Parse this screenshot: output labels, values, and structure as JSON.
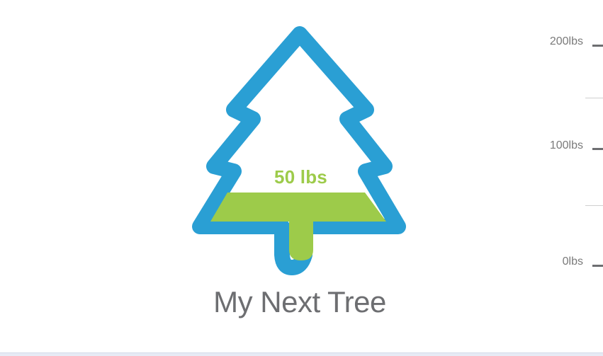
{
  "tree": {
    "title": "My Next Tree",
    "fill_label": "50 lbs",
    "current_lbs": 50,
    "max_lbs": 200,
    "fill_fraction": 0.25,
    "outline_color": "#2a9fd4",
    "fill_color": "#9dcb4a"
  },
  "scale": {
    "major_ticks": [
      {
        "label": "200lbs",
        "value": 200
      },
      {
        "label": "100lbs",
        "value": 100
      },
      {
        "label": "0lbs",
        "value": 0
      }
    ],
    "minor_ticks": [
      150,
      50
    ],
    "label_color": "#7a7a7a",
    "tick_color": "#6d6e71"
  }
}
